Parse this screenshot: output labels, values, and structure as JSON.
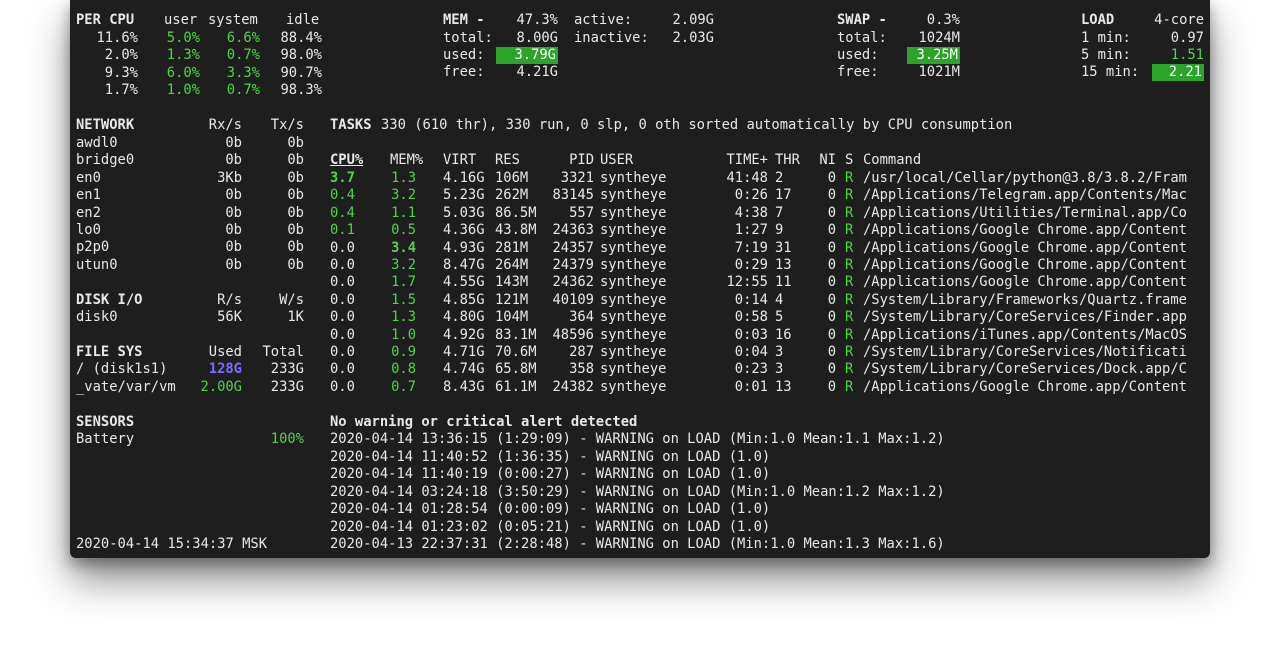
{
  "percpu": {
    "title": "PER CPU",
    "headers": [
      "user",
      "system",
      "idle"
    ],
    "rows": [
      {
        "total": "11.6%",
        "user": "5.0%",
        "system": "6.6%",
        "idle": "88.4%"
      },
      {
        "total": "2.0%",
        "user": "1.3%",
        "system": "0.7%",
        "idle": "98.0%"
      },
      {
        "total": "9.3%",
        "user": "6.0%",
        "system": "3.3%",
        "idle": "90.7%"
      },
      {
        "total": "1.7%",
        "user": "1.0%",
        "system": "0.7%",
        "idle": "98.3%"
      }
    ]
  },
  "mem": {
    "title": "MEM -",
    "percent": "47.3%",
    "total_label": "total:",
    "total": "8.00G",
    "used_label": "used:",
    "used": "3.79G",
    "free_label": "free:",
    "free": "4.21G",
    "active_label": "active:",
    "active": "2.09G",
    "inactive_label": "inactive:",
    "inactive": "2.03G"
  },
  "swap": {
    "title": "SWAP -",
    "percent": "0.3%",
    "total_label": "total:",
    "total": "1024M",
    "used_label": "used:",
    "used": "3.25M",
    "free_label": "free:",
    "free": "1021M"
  },
  "load": {
    "title": "LOAD",
    "cores": "4-core",
    "rows": [
      {
        "label": "1 min:",
        "value": "0.97"
      },
      {
        "label": "5 min:",
        "value": "1.51"
      },
      {
        "label": "15 min:",
        "value": "2.21"
      }
    ]
  },
  "network": {
    "title": "NETWORK",
    "rx_header": "Rx/s",
    "tx_header": "Tx/s",
    "rows": [
      {
        "name": "awdl0",
        "rx": "0b",
        "tx": "0b"
      },
      {
        "name": "bridge0",
        "rx": "0b",
        "tx": "0b"
      },
      {
        "name": "en0",
        "rx": "3Kb",
        "tx": "0b"
      },
      {
        "name": "en1",
        "rx": "0b",
        "tx": "0b"
      },
      {
        "name": "en2",
        "rx": "0b",
        "tx": "0b"
      },
      {
        "name": "lo0",
        "rx": "0b",
        "tx": "0b"
      },
      {
        "name": "p2p0",
        "rx": "0b",
        "tx": "0b"
      },
      {
        "name": "utun0",
        "rx": "0b",
        "tx": "0b"
      }
    ]
  },
  "diskio": {
    "title": "DISK I/O",
    "r_header": "R/s",
    "w_header": "W/s",
    "rows": [
      {
        "name": "disk0",
        "r": "56K",
        "w": "1K"
      }
    ]
  },
  "filesys": {
    "title": "FILE SYS",
    "used_header": "Used",
    "total_header": "Total",
    "rows": [
      {
        "name": "/ (disk1s1)",
        "used": "128G",
        "total": "233G"
      },
      {
        "name": "_vate/var/vm",
        "used": "2.00G",
        "total": "233G"
      }
    ]
  },
  "sensors": {
    "title": "SENSORS",
    "rows": [
      {
        "name": "Battery",
        "value": "100%"
      }
    ]
  },
  "clock": "2020-04-14 15:34:37 MSK",
  "tasks": {
    "title": "TASKS",
    "summary": "330 (610 thr), 330 run, 0 slp, 0 oth sorted automatically by CPU consumption"
  },
  "process_table": {
    "headers": {
      "cpu": "CPU%",
      "mem": "MEM%",
      "virt": "VIRT",
      "res": "RES",
      "pid": "PID",
      "user": "USER",
      "time": "TIME+",
      "thr": "THR",
      "ni": "NI",
      "s": "S",
      "cmd": "Command"
    },
    "rows": [
      {
        "cpu": "3.7",
        "mem": "1.3",
        "virt": "4.16G",
        "res": "106M",
        "pid": "3321",
        "user": "syntheye",
        "time": "41:48",
        "thr": "2",
        "ni": "0",
        "s": "R",
        "cmd": "/usr/local/Cellar/python@3.8/3.8.2/Fram"
      },
      {
        "cpu": "0.4",
        "mem": "3.2",
        "virt": "5.23G",
        "res": "262M",
        "pid": "83145",
        "user": "syntheye",
        "time": "0:26",
        "thr": "17",
        "ni": "0",
        "s": "R",
        "cmd": "/Applications/Telegram.app/Contents/Mac"
      },
      {
        "cpu": "0.4",
        "mem": "1.1",
        "virt": "5.03G",
        "res": "86.5M",
        "pid": "557",
        "user": "syntheye",
        "time": "4:38",
        "thr": "7",
        "ni": "0",
        "s": "R",
        "cmd": "/Applications/Utilities/Terminal.app/Co"
      },
      {
        "cpu": "0.1",
        "mem": "0.5",
        "virt": "4.36G",
        "res": "43.8M",
        "pid": "24363",
        "user": "syntheye",
        "time": "1:27",
        "thr": "9",
        "ni": "0",
        "s": "R",
        "cmd": "/Applications/Google Chrome.app/Content"
      },
      {
        "cpu": "0.0",
        "mem": "3.4",
        "virt": "4.93G",
        "res": "281M",
        "pid": "24357",
        "user": "syntheye",
        "time": "7:19",
        "thr": "31",
        "ni": "0",
        "s": "R",
        "cmd": "/Applications/Google Chrome.app/Content"
      },
      {
        "cpu": "0.0",
        "mem": "3.2",
        "virt": "8.47G",
        "res": "264M",
        "pid": "24379",
        "user": "syntheye",
        "time": "0:29",
        "thr": "13",
        "ni": "0",
        "s": "R",
        "cmd": "/Applications/Google Chrome.app/Content"
      },
      {
        "cpu": "0.0",
        "mem": "1.7",
        "virt": "4.55G",
        "res": "143M",
        "pid": "24362",
        "user": "syntheye",
        "time": "12:55",
        "thr": "11",
        "ni": "0",
        "s": "R",
        "cmd": "/Applications/Google Chrome.app/Content"
      },
      {
        "cpu": "0.0",
        "mem": "1.5",
        "virt": "4.85G",
        "res": "121M",
        "pid": "40109",
        "user": "syntheye",
        "time": "0:14",
        "thr": "4",
        "ni": "0",
        "s": "R",
        "cmd": "/System/Library/Frameworks/Quartz.frame"
      },
      {
        "cpu": "0.0",
        "mem": "1.3",
        "virt": "4.80G",
        "res": "104M",
        "pid": "364",
        "user": "syntheye",
        "time": "0:58",
        "thr": "5",
        "ni": "0",
        "s": "R",
        "cmd": "/System/Library/CoreServices/Finder.app"
      },
      {
        "cpu": "0.0",
        "mem": "1.0",
        "virt": "4.92G",
        "res": "83.1M",
        "pid": "48596",
        "user": "syntheye",
        "time": "0:03",
        "thr": "16",
        "ni": "0",
        "s": "R",
        "cmd": "/Applications/iTunes.app/Contents/MacOS"
      },
      {
        "cpu": "0.0",
        "mem": "0.9",
        "virt": "4.71G",
        "res": "70.6M",
        "pid": "287",
        "user": "syntheye",
        "time": "0:04",
        "thr": "3",
        "ni": "0",
        "s": "R",
        "cmd": "/System/Library/CoreServices/Notificati"
      },
      {
        "cpu": "0.0",
        "mem": "0.8",
        "virt": "4.74G",
        "res": "65.8M",
        "pid": "358",
        "user": "syntheye",
        "time": "0:23",
        "thr": "3",
        "ni": "0",
        "s": "R",
        "cmd": "/System/Library/CoreServices/Dock.app/C"
      },
      {
        "cpu": "0.0",
        "mem": "0.7",
        "virt": "8.43G",
        "res": "61.1M",
        "pid": "24382",
        "user": "syntheye",
        "time": "0:01",
        "thr": "13",
        "ni": "0",
        "s": "R",
        "cmd": "/Applications/Google Chrome.app/Content"
      }
    ]
  },
  "alerts": {
    "title": "No warning or critical alert detected",
    "lines": [
      "2020-04-14 13:36:15 (1:29:09) - WARNING on LOAD (Min:1.0 Mean:1.1 Max:1.2)",
      "2020-04-14 11:40:52 (1:36:35) - WARNING on LOAD (1.0)",
      "2020-04-14 11:40:19 (0:00:27) - WARNING on LOAD (1.0)",
      "2020-04-14 03:24:18 (3:50:29) - WARNING on LOAD (Min:1.0 Mean:1.2 Max:1.2)",
      "2020-04-14 01:28:54 (0:00:09) - WARNING on LOAD (1.0)",
      "2020-04-14 01:23:02 (0:05:21) - WARNING on LOAD (1.0)",
      "2020-04-13 22:37:31 (2:28:48) - WARNING on LOAD (Min:1.0 Mean:1.3 Max:1.6)"
    ]
  }
}
